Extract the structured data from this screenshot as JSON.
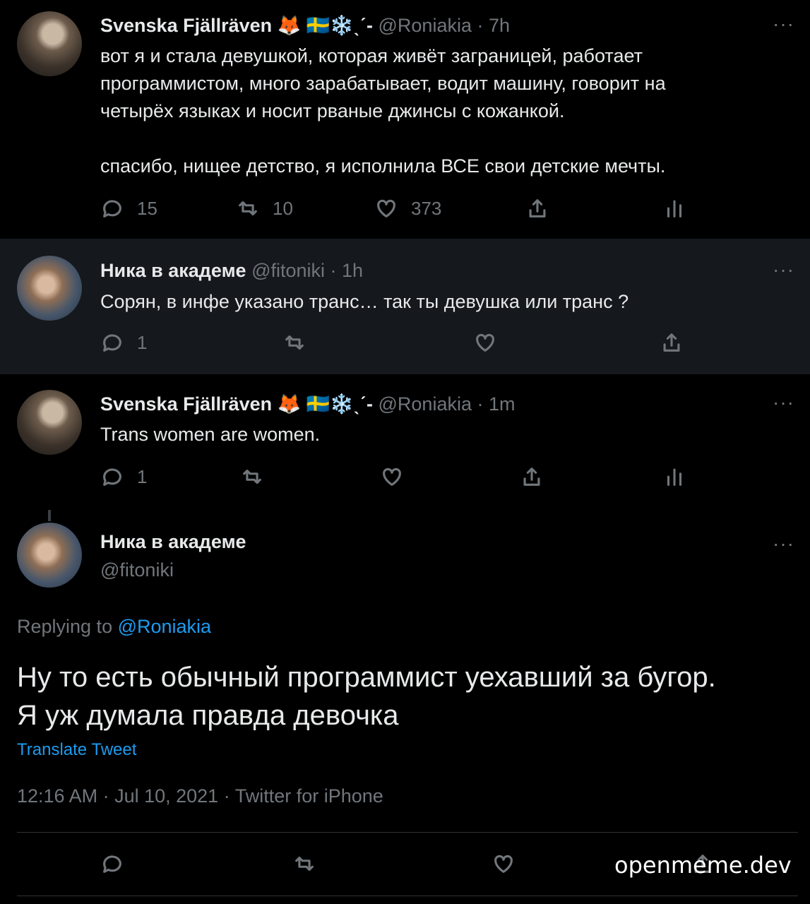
{
  "tweet1": {
    "prefix": "-ˏˋ",
    "name": "Svenska Fjällräven 🦊 🇸🇪❄️ˎˊ-",
    "handle_time": "@Roniakia · 7h",
    "text_lines": [
      "вот я и стала девушкой, которая живёт заграницей, работает",
      "программистом, много зарабатывает, водит машину, говорит на",
      "четырёх языках и носит рваные джинсы с кожанкой.",
      "",
      "спасибо, нищее детство, я исполнила ВСЕ свои детские мечты."
    ],
    "replies": "15",
    "retweets": "10",
    "likes": "373"
  },
  "tweet2": {
    "name": "Ника в академе",
    "handle_time": "@fitoniki · 1h",
    "text": "Сорян, в инфе указано транс… так ты девушка или транс ?",
    "replies": "1"
  },
  "tweet3": {
    "prefix": "-ˏˋ",
    "name": "Svenska Fjällräven 🦊 🇸🇪❄️ˎˊ-",
    "handle_time": "@Roniakia · 1m",
    "text": "Trans women are women.",
    "replies": "1"
  },
  "main": {
    "name": "Ника в академе",
    "handle": "@fitoniki",
    "replying_label": "Replying to ",
    "replying_handle": "@Roniakia",
    "text_line1": "Ну то есть обычный программист уехавший за бугор.",
    "text_line2": "Я уж думала правда девочка",
    "translate": "Translate Tweet",
    "timestamp": "12:16 AM · Jul 10, 2021 · Twitter for iPhone"
  },
  "more_glyph": "···",
  "watermark": "openmeme.dev",
  "colors": {
    "background": "#000000",
    "highlight": "#15181c",
    "text": "#e7e9ea",
    "muted": "#71767b",
    "link": "#1d9bf0"
  }
}
